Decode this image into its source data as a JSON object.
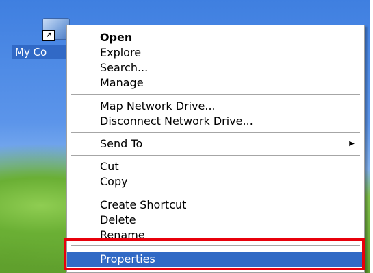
{
  "desktop": {
    "icon": {
      "name": "my-computer-icon",
      "label": "My Co",
      "shortcut_arrow": "↗"
    }
  },
  "context_menu": {
    "groups": [
      [
        {
          "label": "Open",
          "bold": true
        },
        {
          "label": "Explore"
        },
        {
          "label": "Search..."
        },
        {
          "label": "Manage"
        }
      ],
      [
        {
          "label": "Map Network Drive..."
        },
        {
          "label": "Disconnect Network Drive..."
        }
      ],
      [
        {
          "label": "Send To",
          "submenu_arrow": "▶"
        }
      ],
      [
        {
          "label": "Cut"
        },
        {
          "label": "Copy"
        }
      ],
      [
        {
          "label": "Create Shortcut"
        },
        {
          "label": "Delete"
        },
        {
          "label": "Rename"
        }
      ],
      [
        {
          "label": "Properties",
          "selected": true
        }
      ]
    ],
    "selected_color": "#316ac5"
  },
  "annotation": {
    "highlight_color": "#e8000b"
  }
}
